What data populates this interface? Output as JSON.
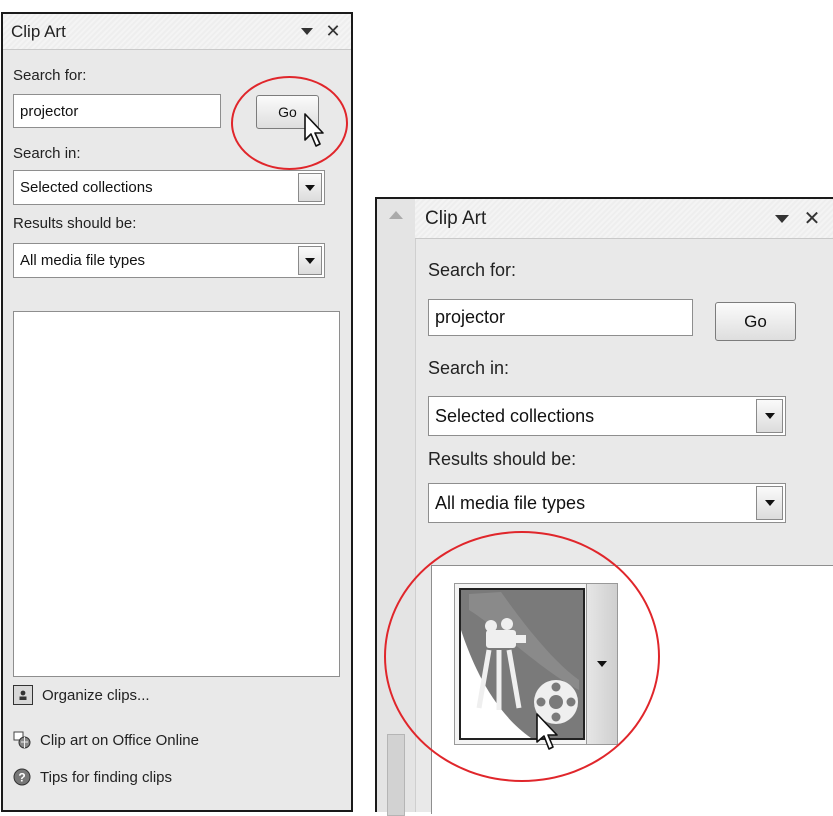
{
  "left_pane": {
    "title": "Clip Art",
    "search_label": "Search for:",
    "search_value": "projector",
    "go_label": "Go",
    "search_in_label": "Search in:",
    "search_in_value": "Selected collections",
    "results_label": "Results should be:",
    "results_value": "All media file types",
    "links": [
      {
        "icon": "organize-clips-icon",
        "label": "Organize clips..."
      },
      {
        "icon": "office-online-icon",
        "label": "Clip art on Office Online"
      },
      {
        "icon": "help-icon",
        "label": "Tips for finding clips"
      }
    ]
  },
  "right_pane": {
    "title": "Clip Art",
    "search_label": "Search for:",
    "search_value": "projector",
    "go_label": "Go",
    "search_in_label": "Search in:",
    "search_in_value": "Selected collections",
    "results_label": "Results should be:",
    "results_value": "All media file types",
    "result_clip_icon": "film-projector-clip-icon"
  },
  "highlight_color": "#e0262b"
}
